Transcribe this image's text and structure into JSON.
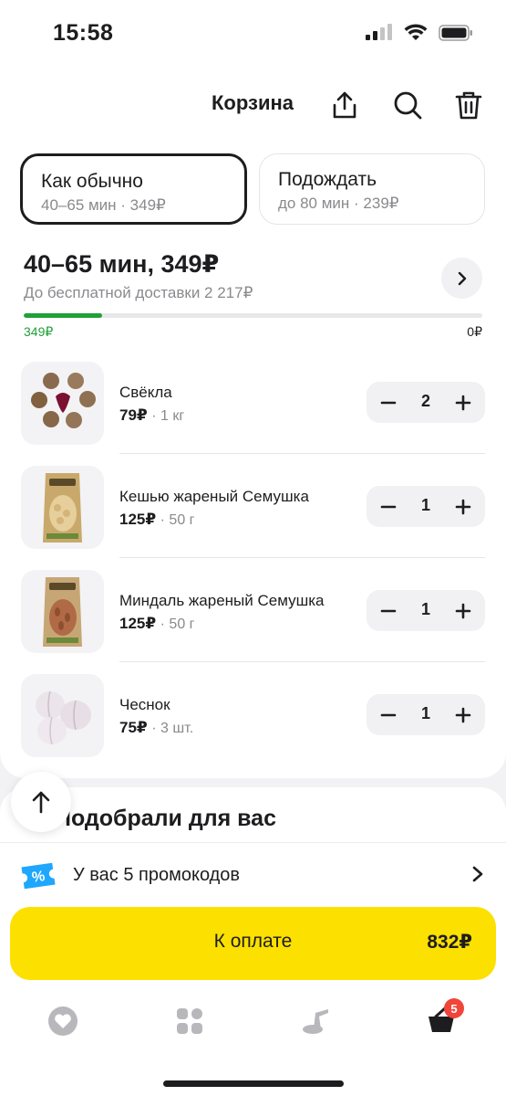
{
  "status": {
    "time": "15:58"
  },
  "header": {
    "title": "Корзина"
  },
  "delivery_options": [
    {
      "title": "Как обычно",
      "subtitle": "40–65 мин · 349₽",
      "selected": true
    },
    {
      "title": "Подождать",
      "subtitle": "до 80 мин · 239₽",
      "selected": false
    }
  ],
  "summary": {
    "title": "40–65 мин, 349₽",
    "subtitle": "До бесплатной доставки 2 217₽",
    "progress_left": "349₽",
    "progress_right": "0₽",
    "progress_fraction": 0.17
  },
  "items": [
    {
      "name": "Свёкла",
      "price": "79₽",
      "unit": " · 1 кг",
      "qty": "2",
      "image": "beetroot"
    },
    {
      "name": "Кешью жареный Семушка",
      "price": "125₽",
      "unit": " · 50 г",
      "qty": "1",
      "image": "cashew-pack"
    },
    {
      "name": "Миндаль жареный Семушка",
      "price": "125₽",
      "unit": " · 50 г",
      "qty": "1",
      "image": "almond-pack"
    },
    {
      "name": "Чеснок",
      "price": "75₽",
      "unit": " · 3 шт.",
      "qty": "1",
      "image": "garlic"
    }
  ],
  "recommendations": {
    "title": "Подобрали для вас"
  },
  "promo": {
    "text": "У вас 5 промокодов",
    "icon": "percent-ticket-icon"
  },
  "checkout": {
    "label": "К оплате",
    "total": "832₽"
  },
  "tabs": [
    {
      "icon": "heart-icon"
    },
    {
      "icon": "grid-icon"
    },
    {
      "icon": "recipes-icon"
    },
    {
      "icon": "cart-icon",
      "badge": "5"
    }
  ],
  "colors": {
    "accent": "#fce000",
    "progress": "#21a038",
    "badge": "#f0453a",
    "promo": "#1ea7fd"
  }
}
